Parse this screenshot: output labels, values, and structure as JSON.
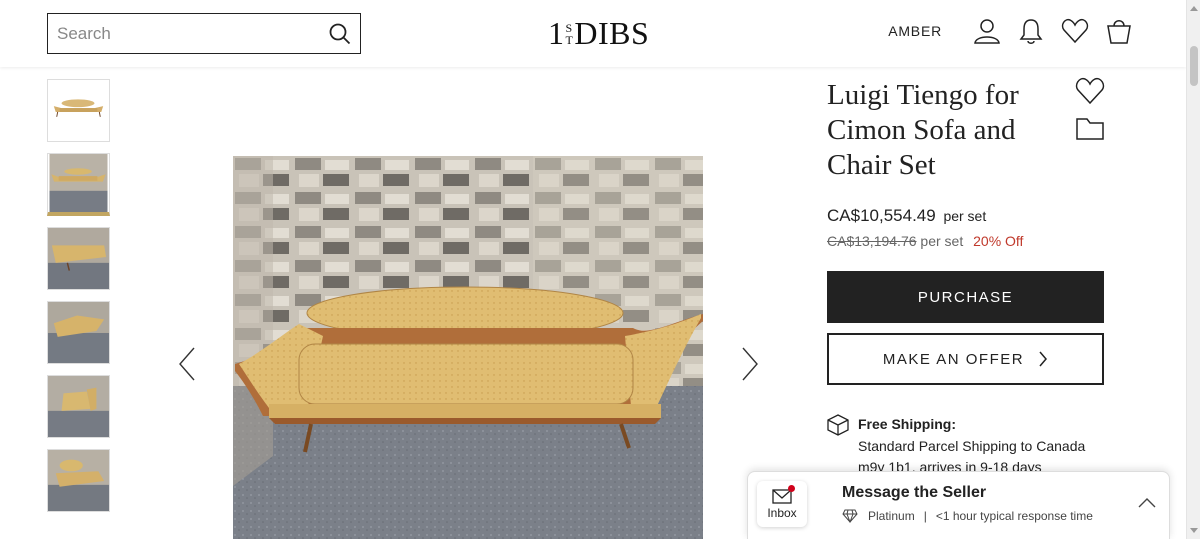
{
  "header": {
    "search_placeholder": "Search",
    "logo_main": "DIBS",
    "logo_digit": "1",
    "logo_st_top": "S",
    "logo_st_bottom": "T",
    "user_name": "AMBER"
  },
  "thumbnails": [
    {
      "alt": "sofa-white-background",
      "active": false
    },
    {
      "alt": "sofa-stone-wall",
      "active": true
    },
    {
      "alt": "sofa-angle",
      "active": false
    },
    {
      "alt": "sofa-side",
      "active": false
    },
    {
      "alt": "chair-back",
      "active": false
    },
    {
      "alt": "chair-front",
      "active": false
    }
  ],
  "product": {
    "title": "Luigi Tiengo for Cimon Sofa and Chair Set",
    "price": "CA$10,554.49",
    "price_unit": "per set",
    "old_price": "CA$13,194.76",
    "old_price_unit": "per set",
    "discount": "20% Off",
    "purchase_label": "PURCHASE",
    "offer_label": "MAKE AN OFFER"
  },
  "shipping": {
    "title": "Free Shipping:",
    "line1": "Standard Parcel Shipping to Canada",
    "line2": "m9y 1b1, arrives in 9-18 days"
  },
  "message_panel": {
    "inbox_label": "Inbox",
    "title": "Message the Seller",
    "tier": "Platinum",
    "separator": "|",
    "response_time": "<1 hour typical response time"
  },
  "colors": {
    "accent_gold": "#c2a661",
    "dark": "#222222",
    "discount_red": "#c0392b",
    "notification_red": "#d0021b"
  }
}
